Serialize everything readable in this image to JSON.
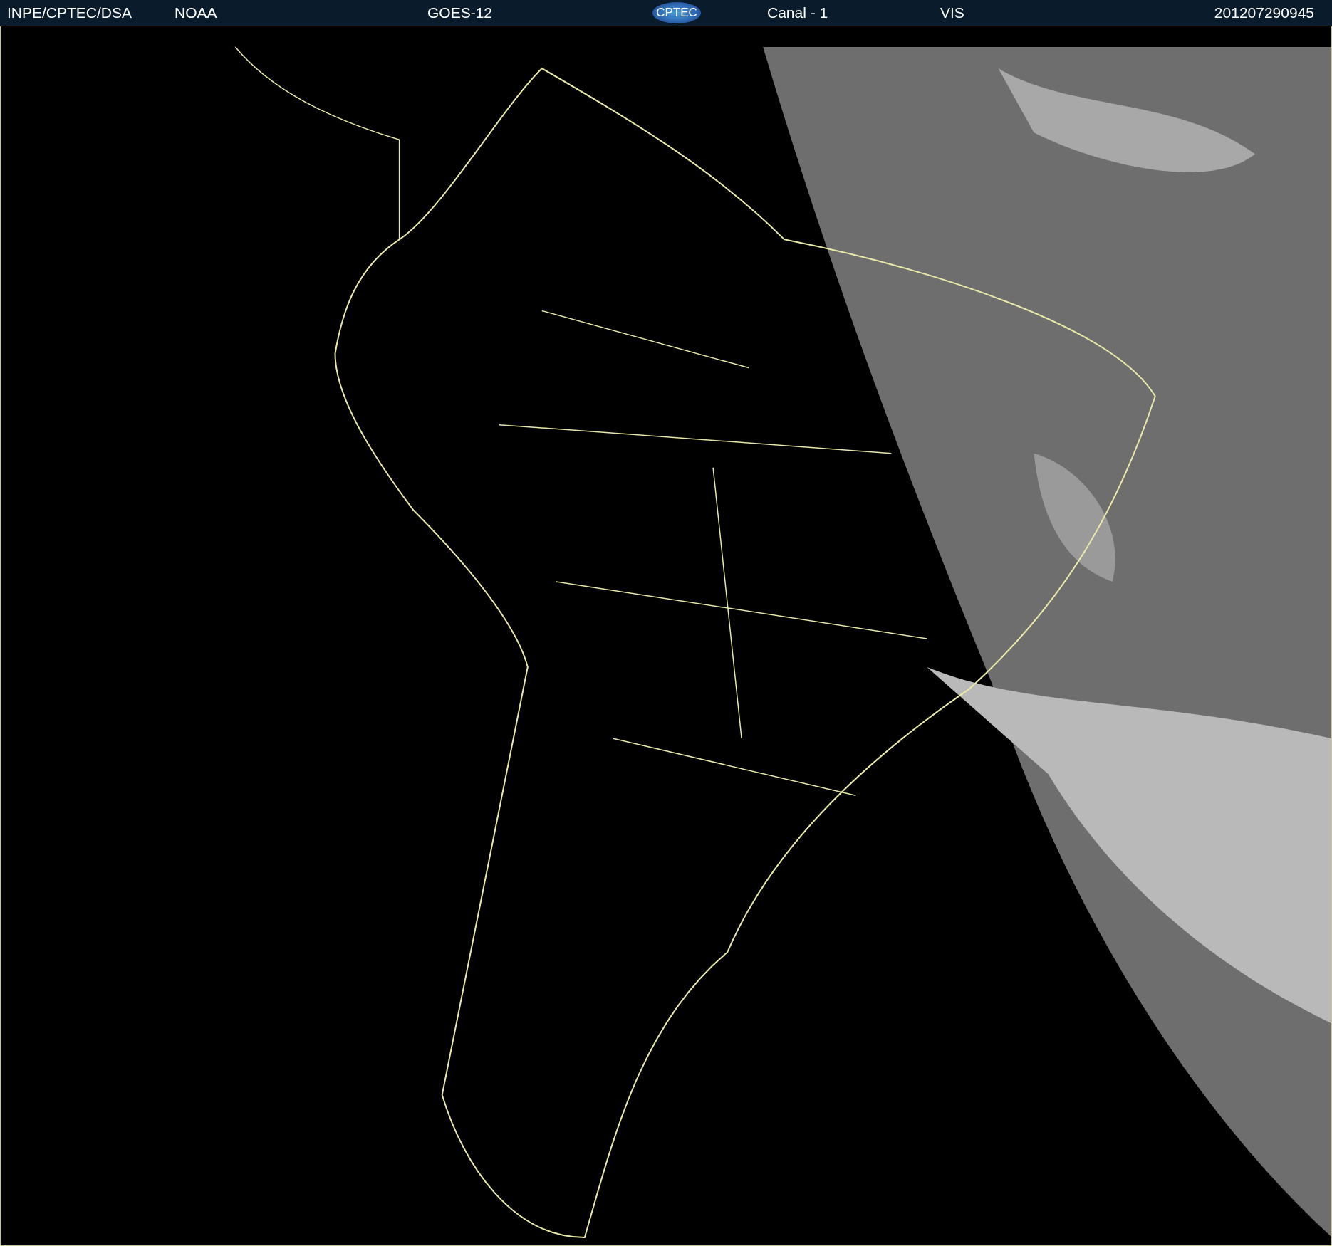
{
  "header": {
    "source": "INPE/CPTEC/DSA",
    "agency": "NOAA",
    "satellite": "GOES-12",
    "logo": "CPTEC",
    "channel": "Canal - 1",
    "band": "VIS",
    "timestamp": "201207290945"
  }
}
